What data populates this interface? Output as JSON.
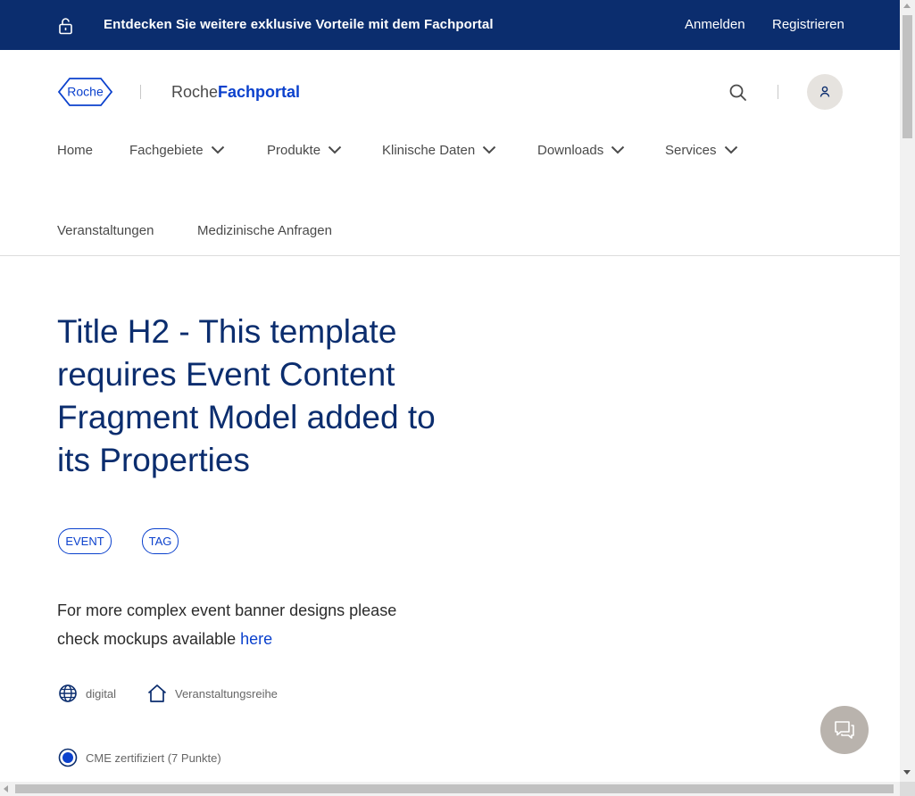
{
  "topbar": {
    "promo_text": "Entdecken Sie weitere exklusive Vorteile mit dem Fachportal",
    "login_label": "Anmelden",
    "register_label": "Registrieren",
    "lock_icon": "lock-icon"
  },
  "header": {
    "logo_text": "Roche",
    "portal_name_prefix": "Roche",
    "portal_name_strong": "Fachportal",
    "search_icon": "search-icon",
    "user_icon": "user-icon"
  },
  "nav": {
    "items": [
      {
        "label": "Home"
      },
      {
        "label": "Fachgebiete"
      },
      {
        "label": "Produkte"
      },
      {
        "label": "Klinische Daten"
      },
      {
        "label": "Downloads"
      },
      {
        "label": "Services"
      },
      {
        "label": "Veranstaltungen"
      },
      {
        "label": "Medizinische Anfragen"
      }
    ]
  },
  "main": {
    "title": "Title H2 - This template requires Event Content Fragment Model added to its Properties",
    "tags": [
      "EVENT",
      "TAG"
    ],
    "description_text": "For more complex event banner designs please check mockups available ",
    "description_link": "here",
    "meta": {
      "format_label": "digital",
      "series_label": "Veranstaltungsreihe",
      "cme_label": "CME zertifiziert (7 Punkte)"
    }
  },
  "chat": {
    "icon": "chat-icon"
  },
  "colors": {
    "brand_dark": "#0b2d6e",
    "brand_blue": "#0b41cd",
    "chat_bg": "#b9b3ad"
  }
}
